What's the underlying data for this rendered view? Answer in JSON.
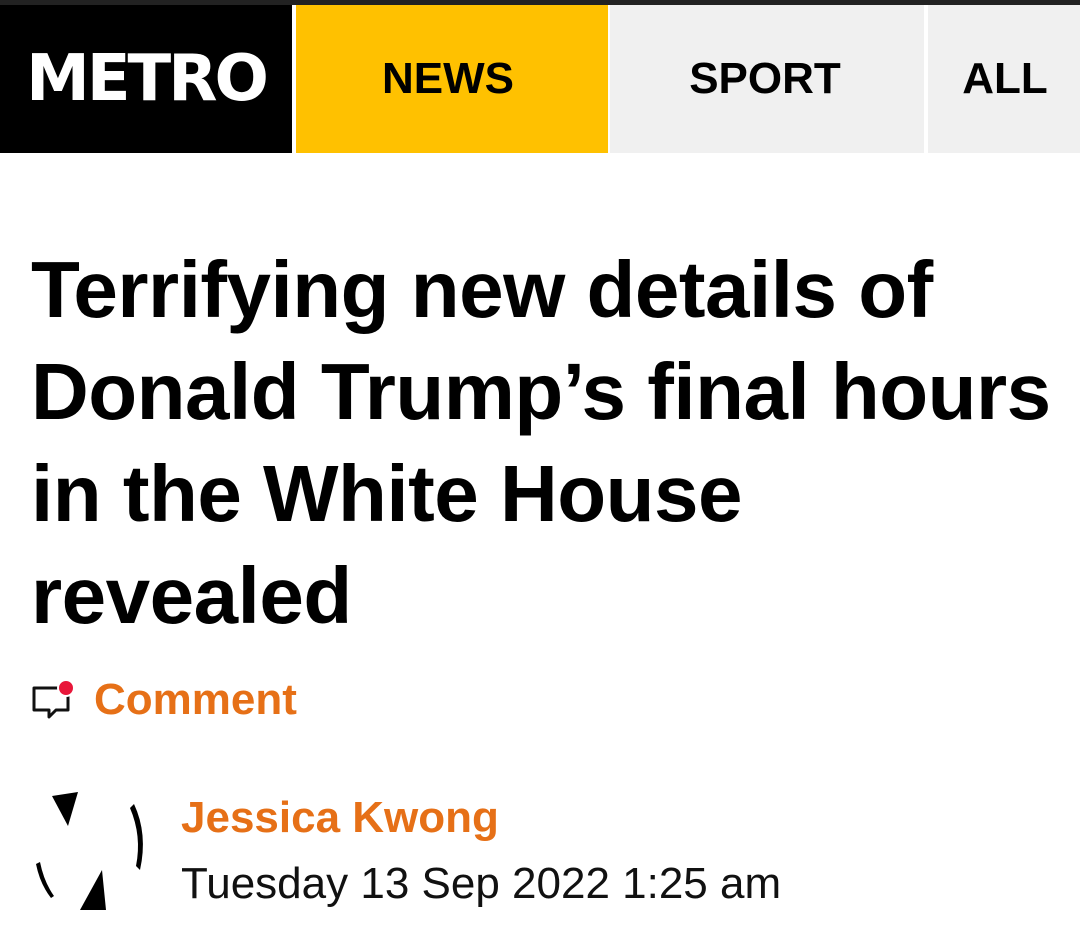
{
  "header": {
    "logo": "METRO",
    "tabs": [
      {
        "label": "NEWS",
        "active": true
      },
      {
        "label": "SPORT",
        "active": false
      },
      {
        "label": "ALL",
        "active": false
      }
    ]
  },
  "article": {
    "headline": "Terrifying new details of Donald Trump’s final hours in the White House revealed",
    "comment_label": "Comment",
    "author": "Jessica Kwong",
    "date": "Tuesday 13 Sep 2022 1:25 am"
  },
  "colors": {
    "brand_yellow": "#ffc100",
    "accent_orange": "#e67017",
    "notification_red": "#e8173a"
  },
  "icons": {
    "comment": "comment-bubble-icon",
    "notification": "notification-dot-icon",
    "avatar": "author-avatar"
  }
}
